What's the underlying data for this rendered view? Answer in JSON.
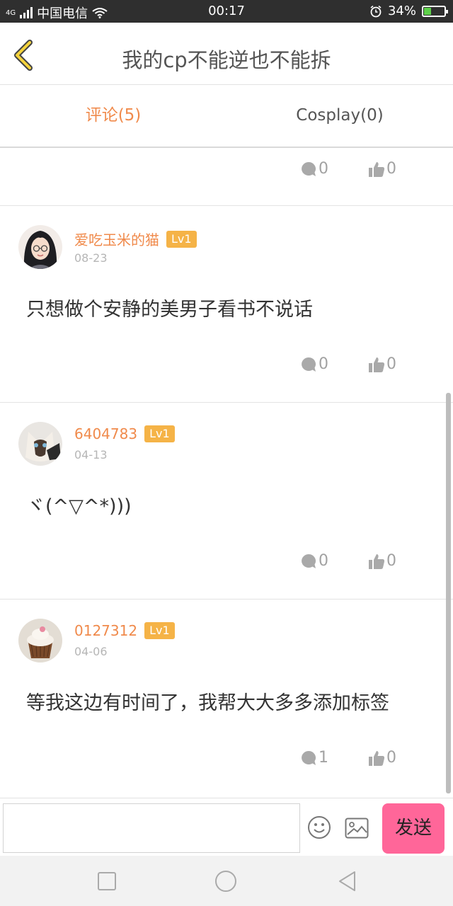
{
  "status_bar": {
    "network": "4G",
    "carrier": "中国电信",
    "time": "00:17",
    "battery": "34%",
    "battery_level": 0.34
  },
  "header": {
    "title": "我的cp不能逆也不能拆"
  },
  "tabs": [
    {
      "label": "评论(5)",
      "active": true
    },
    {
      "label": "Cosplay(0)",
      "active": false
    }
  ],
  "partial_comment": {
    "reply_count": "0",
    "like_count": "0"
  },
  "comments": [
    {
      "username": "爱吃玉米的猫",
      "level": "Lv1",
      "date": "08-23",
      "text": "只想做个安静的美男子看书不说话",
      "reply_count": "0",
      "like_count": "0"
    },
    {
      "username": "6404783",
      "level": "Lv1",
      "date": "04-13",
      "text": "ヾ(^▽^*)))",
      "reply_count": "0",
      "like_count": "0"
    },
    {
      "username": "0127312",
      "level": "Lv1",
      "date": "04-06",
      "text": "等我这边有时间了，我帮大大多多添加标签",
      "reply_count": "1",
      "like_count": "0"
    }
  ],
  "input_bar": {
    "placeholder": "",
    "send_label": "发送"
  },
  "colors": {
    "accent": "#f08a4b",
    "level_badge": "#f5b347",
    "send_button": "#ff6699",
    "status_bar": "#2f2f2f"
  },
  "icons": {
    "back": "chevron-left-icon",
    "reply": "speech-bubble-icon",
    "like": "thumbs-up-icon",
    "emoji": "smiley-icon",
    "image": "image-icon"
  }
}
